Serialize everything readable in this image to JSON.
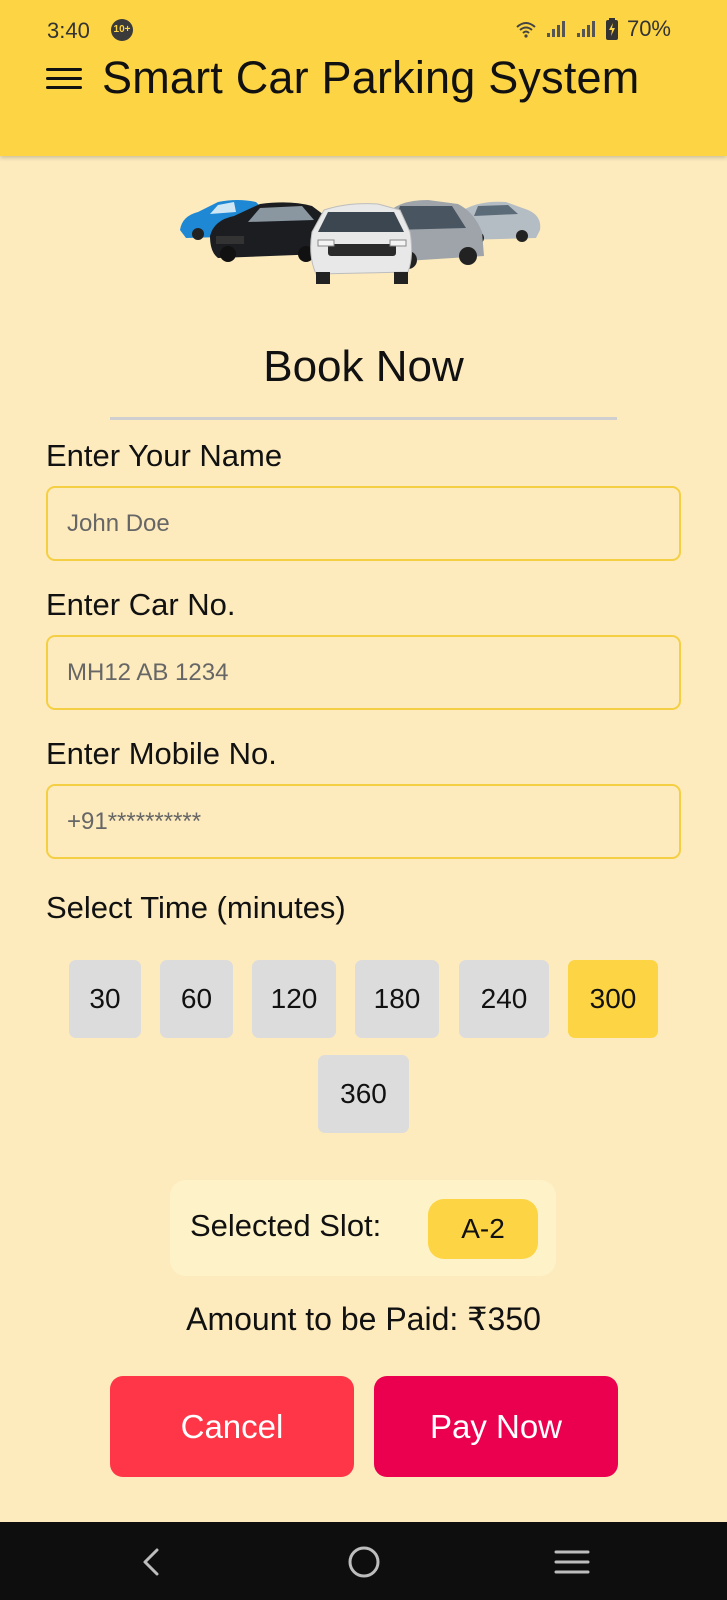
{
  "status_bar": {
    "time": "3:40",
    "notification_badge": "10+",
    "battery": "70%",
    "icons": [
      "wifi-icon",
      "signal-icon",
      "signal-icon",
      "battery-charging-icon"
    ]
  },
  "header": {
    "menu_icon": "hamburger-menu-icon",
    "title": "Smart Car Parking System"
  },
  "hero": {
    "image": "cars-illustration"
  },
  "form": {
    "heading": "Book Now",
    "name": {
      "label": "Enter Your Name",
      "placeholder": "John Doe",
      "value": ""
    },
    "car": {
      "label": "Enter Car No.",
      "placeholder": "MH12 AB 1234",
      "value": ""
    },
    "mobile": {
      "label": "Enter Mobile No.",
      "placeholder": "+91**********",
      "value": ""
    },
    "time_label": "Select Time (minutes)",
    "time_options": [
      "30",
      "60",
      "120",
      "180",
      "240",
      "300",
      "360"
    ],
    "selected_time": "300"
  },
  "slot": {
    "label": "Selected Slot:",
    "value": "A-2"
  },
  "amount": "Amount to be Paid: ₹350",
  "actions": {
    "cancel": "Cancel",
    "pay": "Pay Now"
  },
  "nav": {
    "icons": [
      "back-icon",
      "home-icon",
      "recents-icon"
    ]
  },
  "colors": {
    "header": "#fdd443",
    "background": "#fdebbe",
    "chip": "#dcdcdc",
    "chip_selected": "#fdd443",
    "cancel": "#ff3647",
    "pay": "#eb0050"
  }
}
